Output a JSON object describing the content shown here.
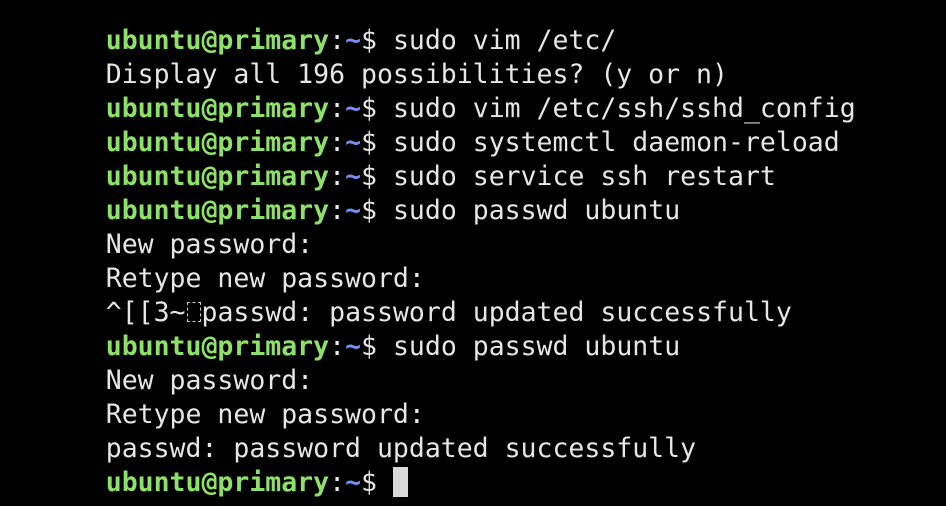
{
  "prompt": {
    "user_host": "ubuntu@primary",
    "colon": ":",
    "path": "~",
    "symbol": "$ "
  },
  "lines": [
    {
      "type": "prompt",
      "command": "sudo vim /etc/"
    },
    {
      "type": "output",
      "text": "Display all 196 possibilities? (y or n)"
    },
    {
      "type": "prompt",
      "command": "sudo vim /etc/ssh/sshd_config"
    },
    {
      "type": "prompt",
      "command": "sudo systemctl daemon-reload"
    },
    {
      "type": "prompt",
      "command": "sudo service ssh restart"
    },
    {
      "type": "prompt",
      "command": "sudo passwd ubuntu"
    },
    {
      "type": "output",
      "text": "New password:"
    },
    {
      "type": "output",
      "text": "Retype new password:"
    },
    {
      "type": "output_ctrl",
      "before": "^[[3~",
      "glyph": "control-char-glyph",
      "after": "passwd: password updated successfully"
    },
    {
      "type": "prompt",
      "command": "sudo passwd ubuntu"
    },
    {
      "type": "output",
      "text": "New password:"
    },
    {
      "type": "output",
      "text": "Retype new password:"
    },
    {
      "type": "output",
      "text": "passwd: password updated successfully"
    },
    {
      "type": "prompt_cursor",
      "command": ""
    }
  ],
  "colors": {
    "background": "#000000",
    "user_host": "#8fe06a",
    "path": "#7b8cf5",
    "text": "#e6e6e6",
    "cursor": "#d9d9d9"
  }
}
